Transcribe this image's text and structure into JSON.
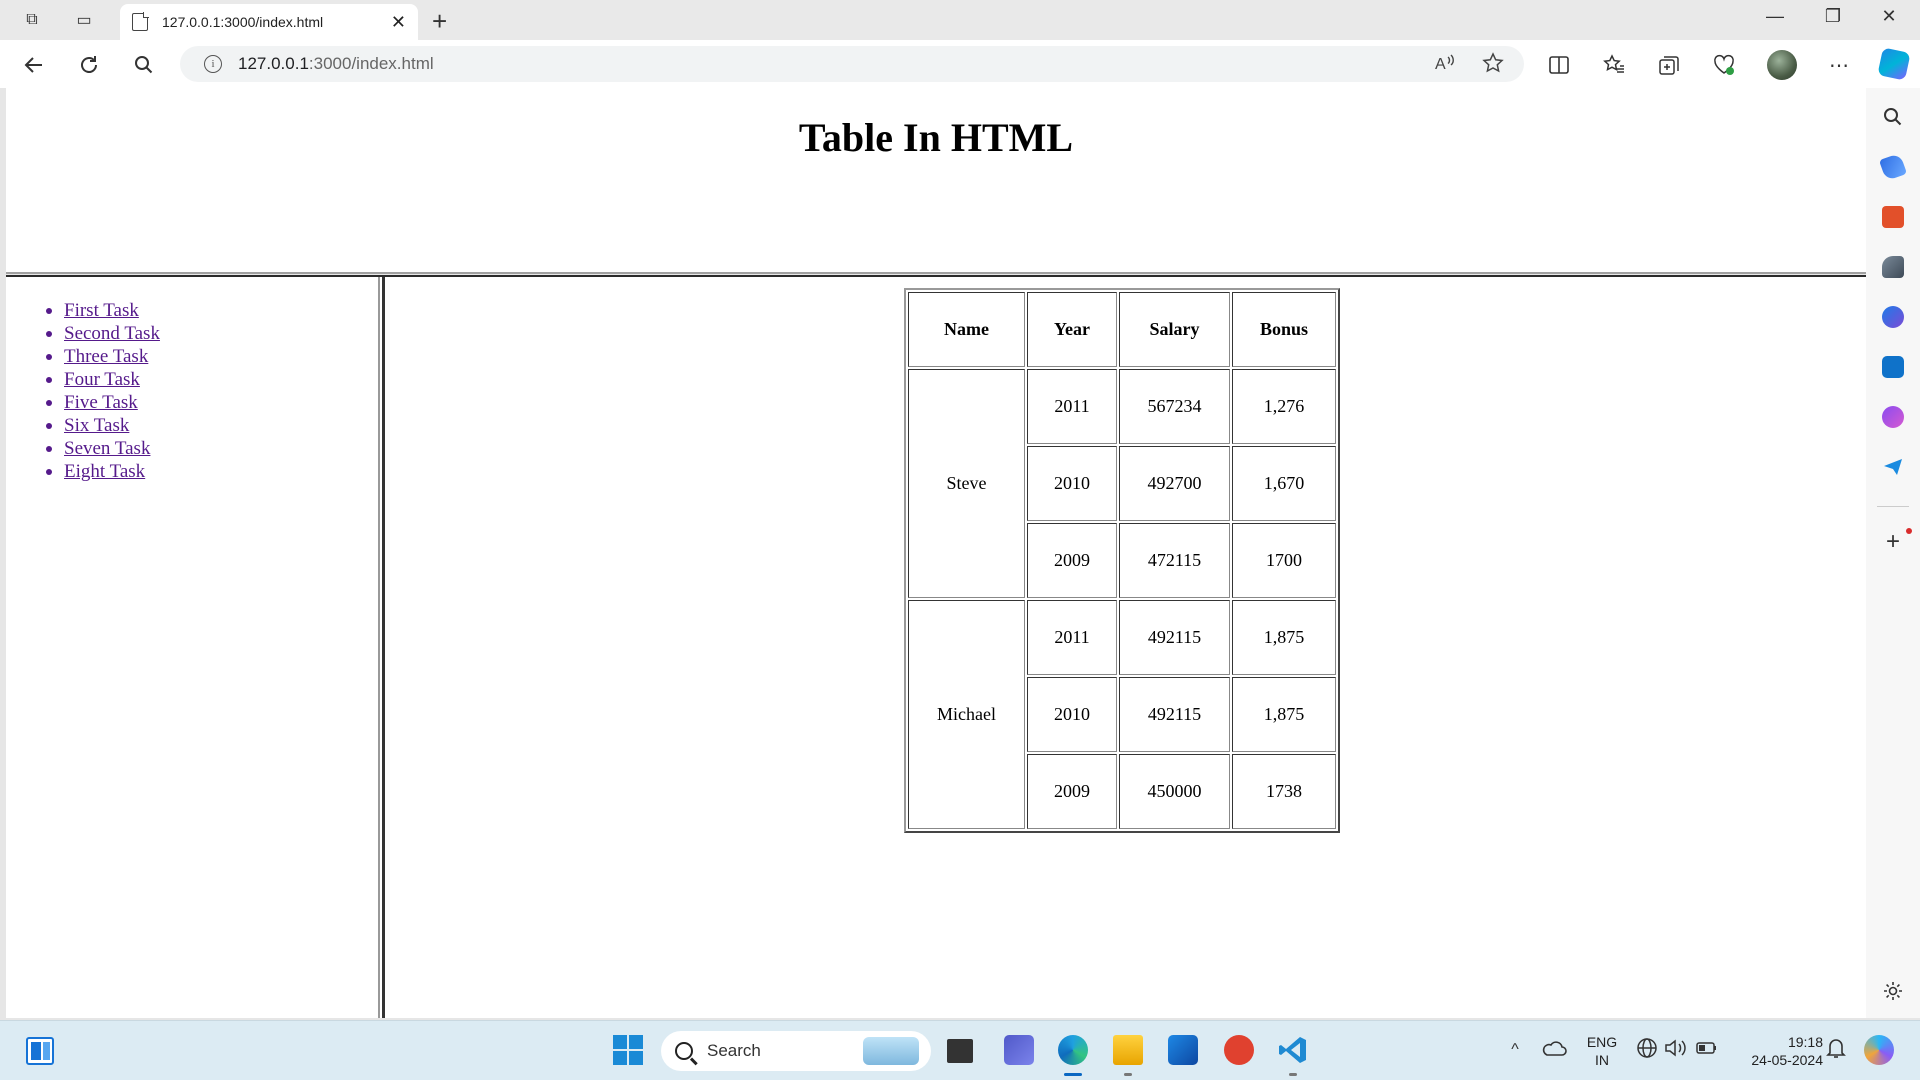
{
  "browser": {
    "tab_title": "127.0.0.1:3000/index.html",
    "tab_close": "✕",
    "new_tab": "+",
    "url_host": "127.0.0.1",
    "url_path": ":3000/index.html",
    "read_aloud": "A)",
    "window_min": "—",
    "window_max": "❐",
    "window_close": "✕"
  },
  "page": {
    "title": "Table In HTML",
    "nav_links": [
      "First Task",
      "Second Task",
      "Three Task",
      "Four Task",
      "Five Task",
      "Six Task",
      "Seven Task",
      "Eight Task"
    ],
    "table": {
      "headers": [
        "Name",
        "Year",
        "Salary",
        "Bonus"
      ],
      "people": [
        {
          "name": "Steve",
          "rows": [
            {
              "year": "2011",
              "salary": "567234",
              "bonus": "1,276"
            },
            {
              "year": "2010",
              "salary": "492700",
              "bonus": "1,670"
            },
            {
              "year": "2009",
              "salary": "472115",
              "bonus": "1700"
            }
          ]
        },
        {
          "name": "Michael",
          "rows": [
            {
              "year": "2011",
              "salary": "492115",
              "bonus": "1,875"
            },
            {
              "year": "2010",
              "salary": "492115",
              "bonus": "1,875"
            },
            {
              "year": "2009",
              "salary": "450000",
              "bonus": "1738"
            }
          ]
        }
      ]
    }
  },
  "taskbar": {
    "search_label": "Search",
    "lang_top": "ENG",
    "lang_bottom": "IN",
    "time": "19:18",
    "date": "24-05-2024"
  },
  "colors": {
    "link_visited": "#551a8b",
    "taskbar_bg": "#dcebf3",
    "edge_blue": "#0a67c2"
  }
}
